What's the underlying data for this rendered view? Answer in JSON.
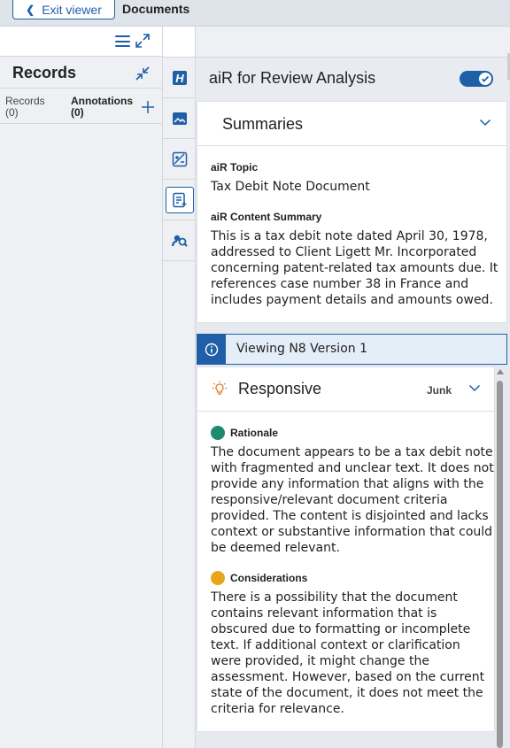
{
  "topbar": {
    "exit_label": "Exit viewer",
    "title": "Documents"
  },
  "left": {
    "title": "Records",
    "tabs": [
      {
        "label": "Records",
        "count": "(0)"
      },
      {
        "label": "Annotations",
        "count": "(0)"
      }
    ]
  },
  "rail": {
    "items": [
      "highlight-icon",
      "image-icon",
      "redact-image-icon",
      "air-review-icon",
      "search-person-icon"
    ],
    "active": "air-review-icon"
  },
  "air": {
    "title": "aiR for Review Analysis",
    "toggle_on": true
  },
  "summaries": {
    "title": "Summaries",
    "topic_label": "aiR Topic",
    "topic_value": "Tax Debit Note Document",
    "content_label": "aiR Content Summary",
    "content_lines": [
      "This is a tax debit note dated April 30, 1978,",
      "addressed to Client Ligett Mr. Incorporated",
      "concerning patent-related tax amounts due. It",
      "references case number 38 in France and",
      "includes payment details and amounts owed."
    ]
  },
  "banner": {
    "text": "Viewing N8 Version 1"
  },
  "responsive": {
    "title": "Responsive",
    "tag": "Junk",
    "rationale_label": "Rationale",
    "rationale_lines": [
      "The document appears to be a tax debit note",
      "with fragmented and unclear text. It does not",
      "provide any information that aligns with the",
      "responsive/relevant document criteria",
      "provided. The content is disjointed and lacks",
      "context or substantive information that could",
      "be deemed relevant."
    ],
    "considerations_label": "Considerations",
    "considerations_lines": [
      "There is a possibility that the document",
      "contains relevant information that is",
      "obscured due to formatting or incomplete",
      "text. If additional context or clarification",
      "were provided, it might change the",
      "assessment. However, based on the current",
      "state of the document, it does not meet the",
      "criteria for relevance."
    ]
  },
  "colors": {
    "accent": "#1f5fa8",
    "rationale_dot": "#1e8a6e",
    "considerations_dot": "#e8a51d",
    "bulb": "#e07b28"
  }
}
